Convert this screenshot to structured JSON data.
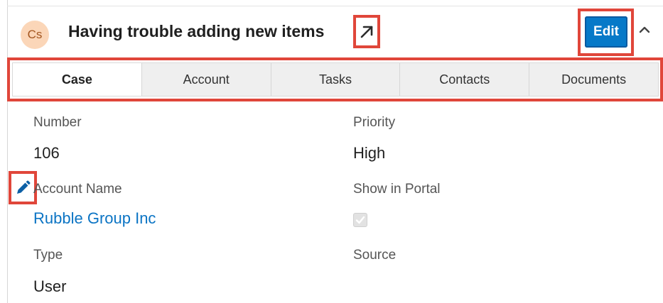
{
  "record": {
    "avatar_initials": "Cs",
    "title": "Having trouble adding new items",
    "edit_label": "Edit"
  },
  "tabs": [
    {
      "label": "Case",
      "active": true
    },
    {
      "label": "Account",
      "active": false
    },
    {
      "label": "Tasks",
      "active": false
    },
    {
      "label": "Contacts",
      "active": false
    },
    {
      "label": "Documents",
      "active": false
    }
  ],
  "fields": {
    "number": {
      "label": "Number",
      "value": "106"
    },
    "priority": {
      "label": "Priority",
      "value": "High"
    },
    "account_name": {
      "label": "Account Name",
      "value": "Rubble Group Inc"
    },
    "show_in_portal": {
      "label": "Show in Portal",
      "checked": true
    },
    "type": {
      "label": "Type",
      "value": "User"
    },
    "source": {
      "label": "Source",
      "value": ""
    }
  },
  "colors": {
    "accent": "#0679c8",
    "highlight": "#e0463a",
    "link": "#0b74c4",
    "avatar_bg": "#fbd6b8"
  },
  "icons": [
    "external-link-icon",
    "chevron-up-icon",
    "pencil-icon",
    "checkmark-icon"
  ]
}
